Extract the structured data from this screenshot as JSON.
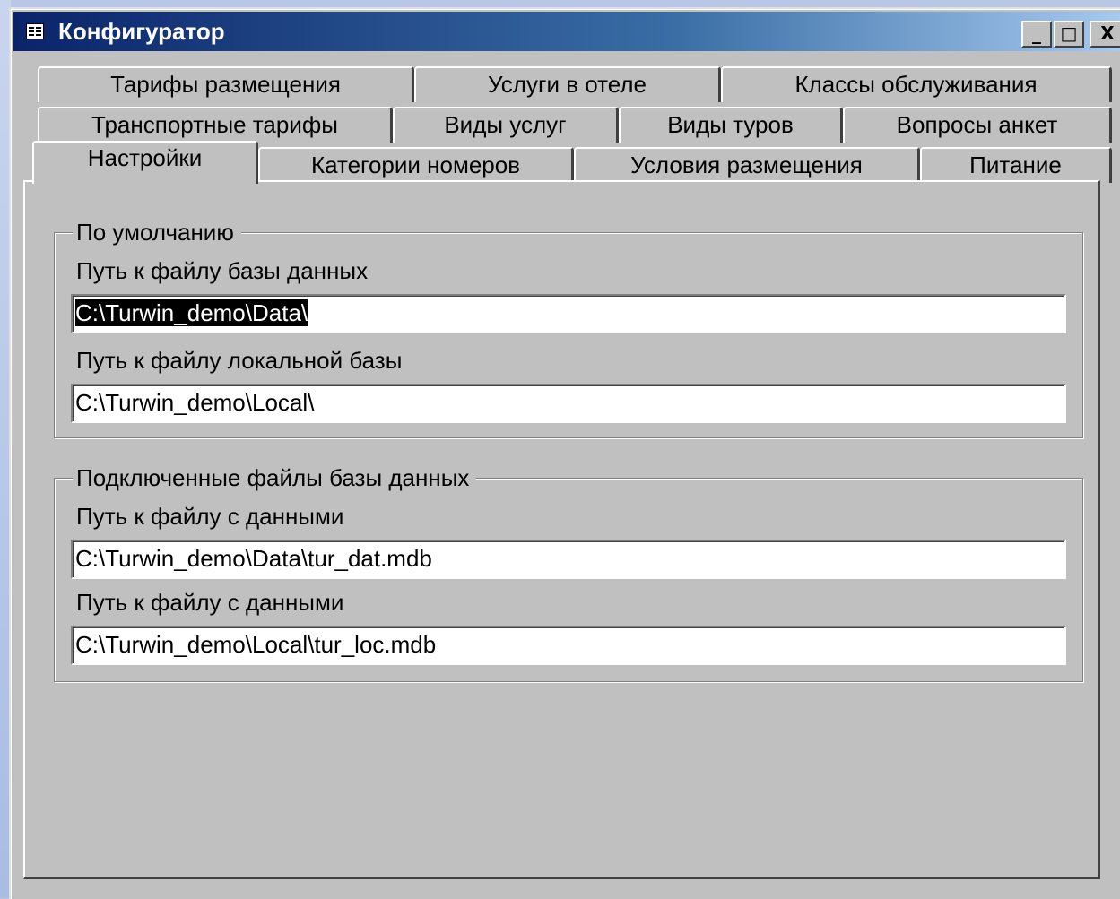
{
  "window": {
    "title": "Конфигуратор",
    "buttons": {
      "minimize": "_",
      "maximize": "□",
      "close": "X"
    }
  },
  "tabs": {
    "row1": [
      "Тарифы размещения",
      "Услуги в отеле",
      "Классы обслуживания"
    ],
    "row2": [
      "Транспортные тарифы",
      "Виды услуг",
      "Виды туров",
      "Вопросы анкет"
    ],
    "row3": [
      "Настройки",
      "Категории номеров",
      "Условия размещения",
      "Питание"
    ],
    "active": "Настройки"
  },
  "defaults": {
    "legend": "По умолчанию",
    "db_path_label": "Путь к файлу базы данных",
    "db_path_value": "C:\\Turwin_demo\\Data\\",
    "local_path_label": "Путь к файлу локальной базы",
    "local_path_value": "C:\\Turwin_demo\\Local\\"
  },
  "connected": {
    "legend": "Подключенные файлы базы данных",
    "data_file_label": "Путь к файлу с данными",
    "data_file_value": "C:\\Turwin_demo\\Data\\tur_dat.mdb",
    "local_file_label": "Путь к файлу с данными",
    "local_file_value": "C:\\Turwin_demo\\Local\\tur_loc.mdb"
  }
}
